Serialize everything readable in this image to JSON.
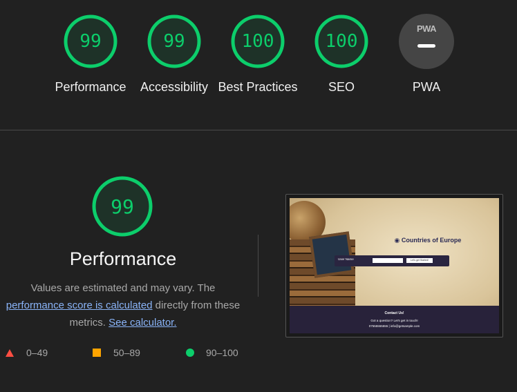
{
  "categories": [
    {
      "label": "Performance",
      "score": "99",
      "value": 99
    },
    {
      "label": "Accessibility",
      "score": "99",
      "value": 99
    },
    {
      "label": "Best Practices",
      "score": "100",
      "value": 100
    },
    {
      "label": "SEO",
      "score": "100",
      "value": 100
    },
    {
      "label": "PWA",
      "badge": "PWA",
      "icon": "pwa-dash-icon"
    }
  ],
  "detail": {
    "score": "99",
    "value": 99,
    "title": "Performance",
    "desc_line1": "Values are estimated and may vary. The",
    "link1": "performance score is calculated",
    "desc_after_link1": " directly from these",
    "desc_line3": "metrics.",
    "link2": "See calculator."
  },
  "legend": {
    "fail": "0–49",
    "average": "50–89",
    "pass": "90–100"
  },
  "thumbnail": {
    "title": "Countries of Europe",
    "form_label": "User Name",
    "button": "Let's get Started!",
    "footer_title": "Contact Us!",
    "footer_line1": "Got a question? Let's get in touch!",
    "footer_line2": "07555555555 | info@getsample.com"
  },
  "colors": {
    "pass": "#0cce6b",
    "average": "#ffa400",
    "fail": "#ff4e42",
    "background": "#212121",
    "link": "#8ab4f8"
  }
}
